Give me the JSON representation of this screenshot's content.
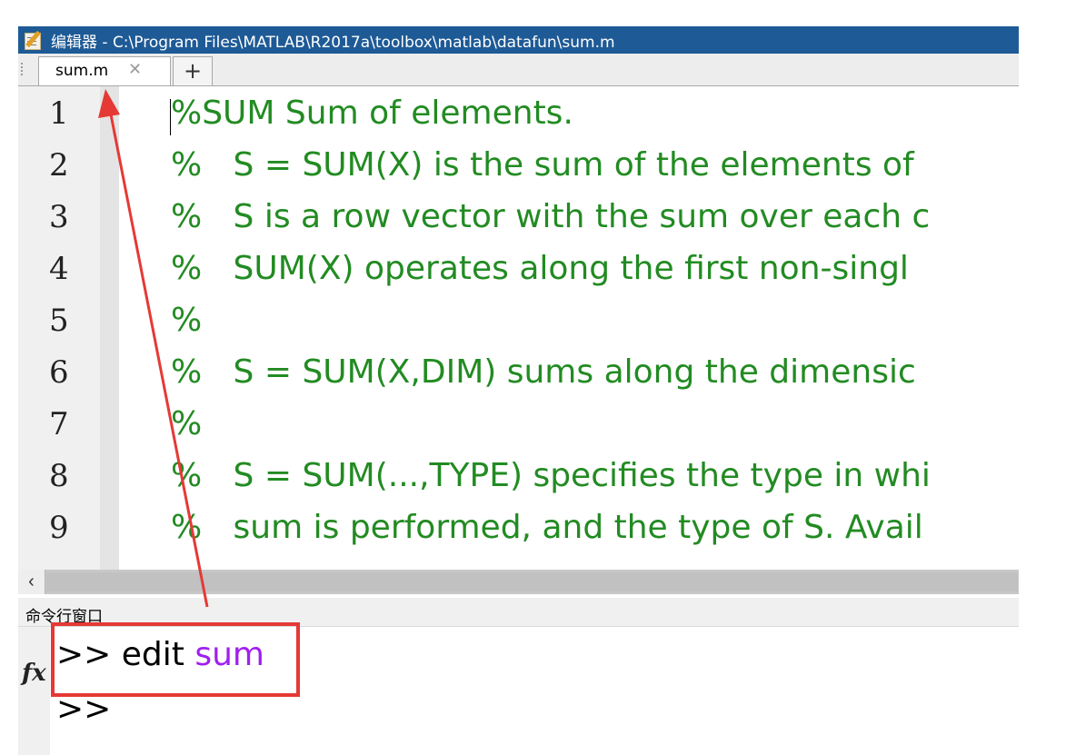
{
  "window": {
    "title": "编辑器 - C:\\Program Files\\MATLAB\\R2017a\\toolbox\\matlab\\datafun\\sum.m",
    "icon": "editor-app-icon"
  },
  "tabs": {
    "items": [
      {
        "label": "sum.m",
        "close_glyph": "✕",
        "active": true
      }
    ],
    "new_tab_glyph": "+"
  },
  "editor": {
    "lines": [
      {
        "number": "1",
        "text": "%SUM Sum of elements."
      },
      {
        "number": "2",
        "text": "%   S = SUM(X) is the sum of the elements of"
      },
      {
        "number": "3",
        "text": "%   S is a row vector with the sum over each c"
      },
      {
        "number": "4",
        "text": "%   SUM(X) operates along the first non-singl"
      },
      {
        "number": "5",
        "text": "%"
      },
      {
        "number": "6",
        "text": "%   S = SUM(X,DIM) sums along the dimensic"
      },
      {
        "number": "7",
        "text": "%"
      },
      {
        "number": "8",
        "text": "%   S = SUM(...,TYPE) specifies the type in whi"
      },
      {
        "number": "9",
        "text": "%   sum is performed, and the type of S. Avail"
      }
    ],
    "comment_color": "#228b22"
  },
  "scrollbar": {
    "left_glyph": "‹"
  },
  "command_window": {
    "title": "命令行窗口",
    "fx_label": "fx",
    "lines": [
      {
        "prompt": ">>",
        "command": "edit",
        "argument": "sum"
      },
      {
        "prompt": ">>",
        "command": "",
        "argument": ""
      }
    ],
    "argument_color": "#a020f0"
  },
  "annotation": {
    "color": "#e53935"
  }
}
